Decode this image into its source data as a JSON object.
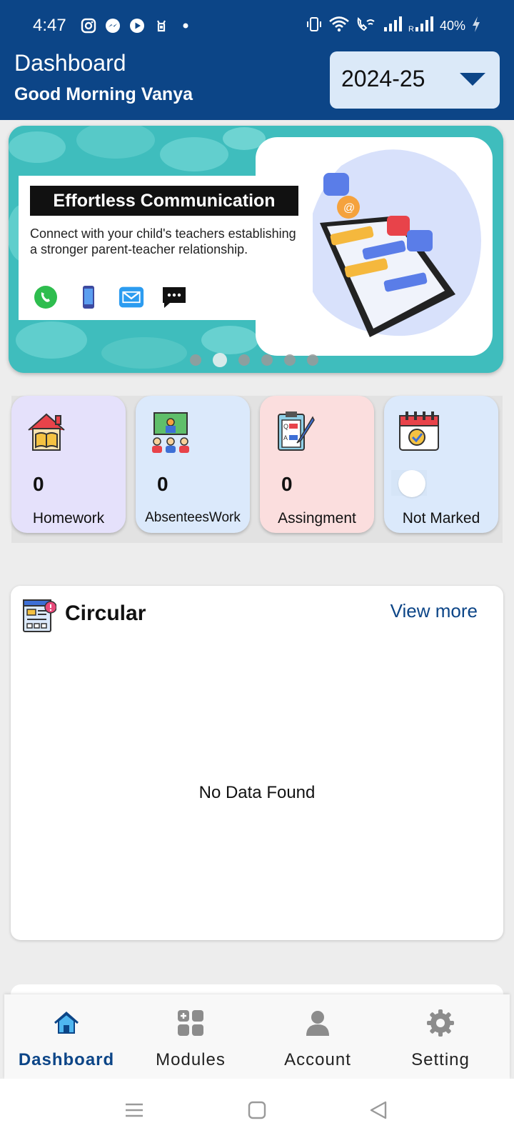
{
  "status_bar": {
    "time": "4:47",
    "battery": "40%"
  },
  "header": {
    "title": "Dashboard",
    "greeting": "Good Morning Vanya",
    "year_selected": "2024-25"
  },
  "banner": {
    "title": "Effortless Communication",
    "text": "Connect with your child's teachers establishing a stronger parent-teacher relationship.",
    "active_slide": 2,
    "slide_count": 6
  },
  "tiles": [
    {
      "count": "0",
      "label": "Homework",
      "icon": "house-book-icon"
    },
    {
      "count": "0",
      "label": "AbsenteesWork",
      "icon": "classroom-icon"
    },
    {
      "count": "0",
      "label": "Assingment",
      "icon": "clipboard-icon"
    },
    {
      "count": "",
      "label": "Not Marked",
      "icon": "calendar-check-icon"
    }
  ],
  "circular": {
    "title": "Circular",
    "view_more": "View more",
    "empty_text": "No Data Found"
  },
  "bottom_nav": [
    {
      "label": "Dashboard",
      "icon": "home-icon",
      "active": true
    },
    {
      "label": "Modules",
      "icon": "grid-icon",
      "active": false
    },
    {
      "label": "Account",
      "icon": "person-icon",
      "active": false
    },
    {
      "label": "Setting",
      "icon": "gear-icon",
      "active": false
    }
  ],
  "colors": {
    "primary": "#0c4587",
    "background": "#ededed"
  }
}
